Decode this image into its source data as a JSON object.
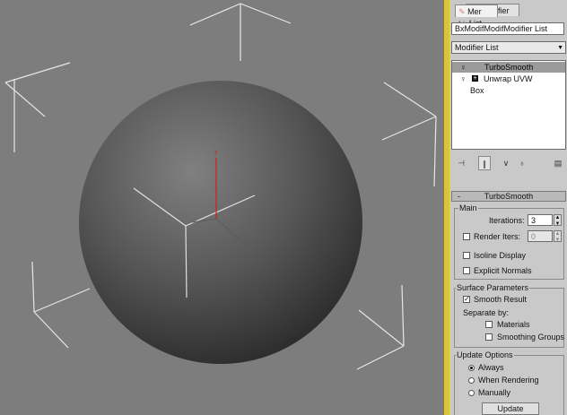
{
  "tabs": {
    "active": "Mer List",
    "behind": "ifier List"
  },
  "modifier_name_field": "BxModifModifModifier List",
  "modifier_list_dropdown": "Modifier List",
  "stack": [
    {
      "label": "TurboSmooth",
      "selected": true
    },
    {
      "label": "Unwrap UVW",
      "selected": false
    },
    {
      "label": "Box",
      "selected": false
    }
  ],
  "toolbar_icons": [
    "pin-stack-icon",
    "show-end-result-icon",
    "make-unique-icon",
    "remove-modifier-icon",
    "configure-modifier-sets-icon"
  ],
  "rollout_title": "TurboSmooth",
  "main": {
    "group_label": "Main",
    "iterations_label": "Iterations:",
    "iterations_value": "3",
    "render_iters_label": "Render Iters:",
    "render_iters_value": "0",
    "render_iters_checked": false,
    "isoline_label": "Isoline Display",
    "isoline_checked": false,
    "explicit_normals_label": "Explicit Normals",
    "explicit_normals_checked": false
  },
  "surface": {
    "group_label": "Surface Parameters",
    "smooth_result_label": "Smooth Result",
    "smooth_result_checked": true,
    "separate_by_label": "Separate by:",
    "materials_label": "Materials",
    "materials_checked": false,
    "smoothing_groups_label": "Smoothing Groups",
    "smoothing_groups_checked": false
  },
  "update": {
    "group_label": "Update Options",
    "options": [
      "Always",
      "When Rendering",
      "Manually"
    ],
    "selected": "Always",
    "update_button": "Update"
  },
  "viewport": {
    "axis_label": "z"
  },
  "colors": {
    "selection_border": "#d9c43a",
    "axis_z": "#cc2222",
    "panel_bg": "#c9c9c9",
    "viewport_bg": "#7d7d7d"
  }
}
